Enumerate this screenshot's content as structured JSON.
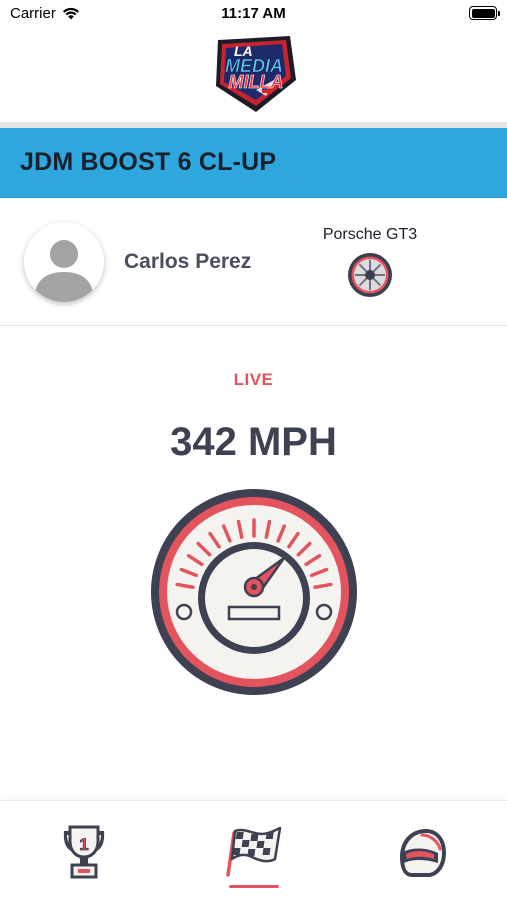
{
  "status_bar": {
    "carrier": "Carrier",
    "time": "11:17 AM",
    "wifi_icon": "wifi-icon",
    "battery_icon": "battery-icon"
  },
  "header": {
    "logo": {
      "line1": "LA",
      "line2": "MEDIA",
      "line3": "MILLA",
      "icon": "la-media-milla-logo"
    }
  },
  "event": {
    "title": "JDM BOOST 6 CL-UP"
  },
  "driver": {
    "name": "Carlos Perez",
    "avatar_icon": "avatar-placeholder-icon",
    "car": "Porsche GT3",
    "car_icon": "tire-icon"
  },
  "live": {
    "status": "LIVE",
    "speed": "342 MPH",
    "gauge_icon": "speedometer-icon"
  },
  "tabs": [
    {
      "name": "leaderboard",
      "icon": "trophy-icon",
      "active": false
    },
    {
      "name": "race",
      "icon": "checkered-flag-icon",
      "active": true
    },
    {
      "name": "driver",
      "icon": "helmet-icon",
      "active": false
    }
  ],
  "colors": {
    "accent_blue": "#2ea7de",
    "accent_red": "#e3545e",
    "text_dark": "#3d4152",
    "gauge_bg": "#f5f3ef"
  }
}
